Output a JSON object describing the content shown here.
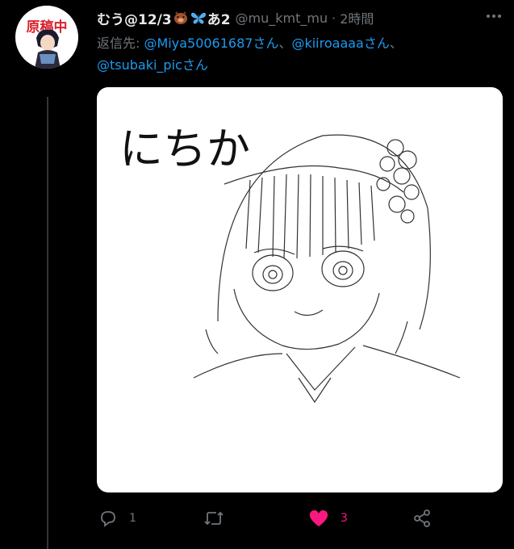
{
  "author": {
    "display_name": "むう@12/3",
    "name_suffix": "あ2",
    "handle": "@mu_kmt_mu",
    "separator": "·",
    "time": "2時間",
    "avatar_text": "原稿中"
  },
  "reply": {
    "prefix": "返信先: ",
    "mentions": [
      "@Miya50061687さん",
      "@kiiroaaaaさん",
      "@tsubaki_picさん"
    ],
    "separator": "、"
  },
  "media": {
    "handwritten_text": "にちか"
  },
  "actions": {
    "reply_count": "1",
    "like_count": "3"
  },
  "colors": {
    "background": "#000000",
    "text": "#e7e9ea",
    "secondary": "#71767b",
    "link": "#1d9bf0",
    "like": "#f91880"
  }
}
